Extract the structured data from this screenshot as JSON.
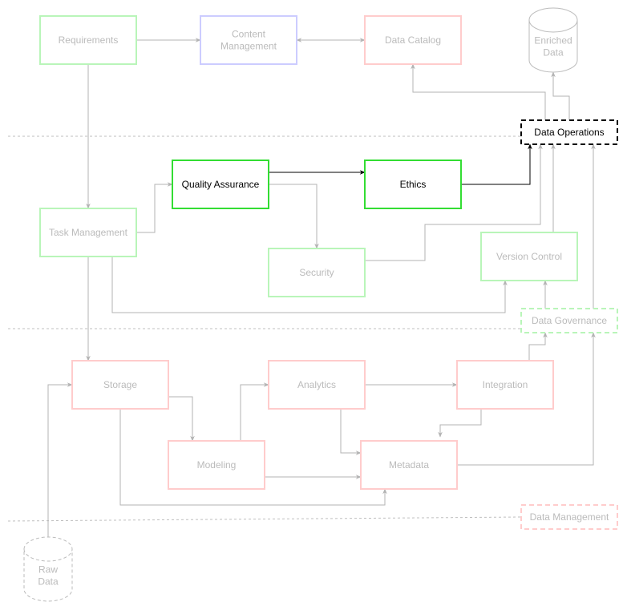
{
  "colors": {
    "green_faded": "#b9f5b9",
    "green_bright": "#33dd33",
    "purple": "#ccccff",
    "pink": "#ffcccc",
    "gray_line": "#b3b3b3",
    "gray_text": "#bbbbbb",
    "black": "#000000"
  },
  "nodes": {
    "requirements": {
      "label": "Requirements"
    },
    "content_management": {
      "label": "Content Management"
    },
    "data_catalog": {
      "label": "Data Catalog"
    },
    "enriched_data": {
      "label": "Enriched Data"
    },
    "data_operations": {
      "label": "Data Operations"
    },
    "quality_assurance": {
      "label": "Quality Assurance"
    },
    "ethics": {
      "label": "Ethics"
    },
    "task_management": {
      "label": "Task Management"
    },
    "security": {
      "label": "Security"
    },
    "version_control": {
      "label": "Version Control"
    },
    "data_governance": {
      "label": "Data Governance"
    },
    "storage": {
      "label": "Storage"
    },
    "analytics": {
      "label": "Analytics"
    },
    "integration": {
      "label": "Integration"
    },
    "modeling": {
      "label": "Modeling"
    },
    "metadata": {
      "label": "Metadata"
    },
    "data_management": {
      "label": "Data Management"
    },
    "raw_data": {
      "label": "Raw Data"
    }
  }
}
